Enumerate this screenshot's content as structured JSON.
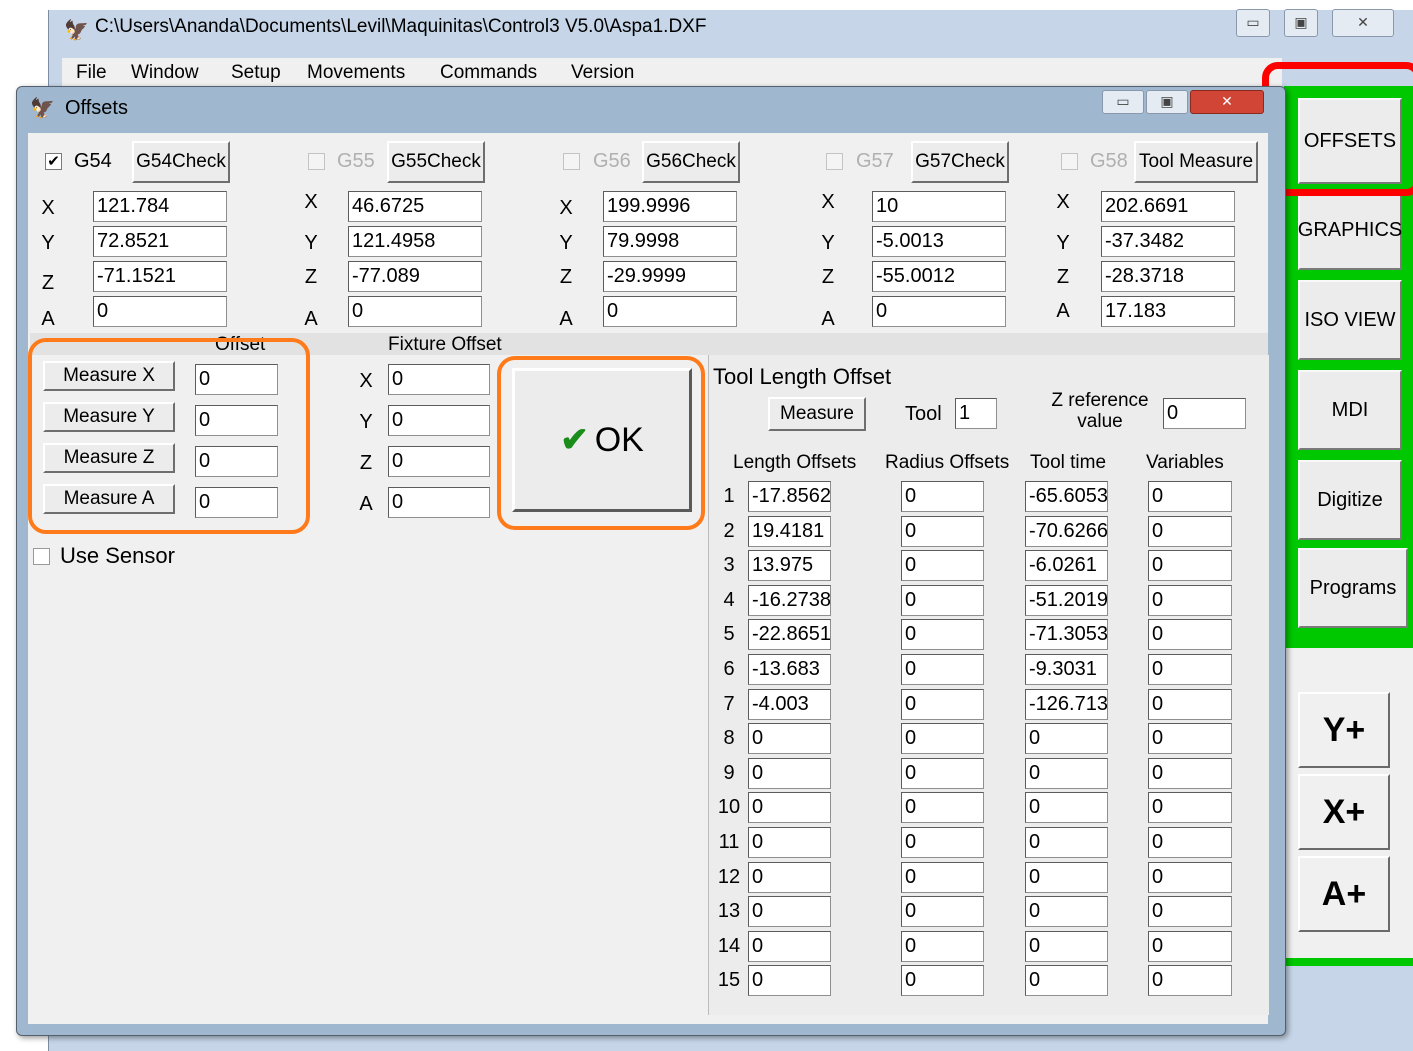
{
  "main_window": {
    "title": "C:\\Users\\Ananda\\Documents\\Levil\\Maquinitas\\Control3 V5.0\\Aspa1.DXF",
    "controls": [
      "▭",
      "▣",
      "✕"
    ],
    "menu": [
      "File",
      "Window",
      "Setup",
      "Movements",
      "Commands",
      "Version"
    ]
  },
  "side_panel": {
    "buttons": [
      "OFFSETS",
      "GRAPHICS",
      "ISO VIEW",
      "MDI",
      "Digitize",
      "Programs"
    ],
    "jog": [
      "Y+",
      "X+",
      "A+"
    ],
    "accent_color": "#00c800",
    "highlight_color": "#ff0000"
  },
  "dialog": {
    "title": "Offsets",
    "controls": [
      "▭",
      "▣",
      "✕"
    ],
    "axis_labels": [
      "X",
      "Y",
      "Z",
      "A"
    ],
    "workspaces": [
      {
        "name": "G54",
        "checked": true,
        "button": "G54Check",
        "values": [
          "121.784",
          "72.8521",
          "-71.1521",
          "0"
        ]
      },
      {
        "name": "G55",
        "checked": false,
        "button": "G55Check",
        "values": [
          "46.6725",
          "121.4958",
          "-77.089",
          "0"
        ]
      },
      {
        "name": "G56",
        "checked": false,
        "button": "G56Check",
        "values": [
          "199.9996",
          "79.9998",
          "-29.9999",
          "0"
        ]
      },
      {
        "name": "G57",
        "checked": false,
        "button": "G57Check",
        "values": [
          "10",
          "-5.0013",
          "-55.0012",
          "0"
        ]
      },
      {
        "name": "G58",
        "checked": false,
        "button": "Tool Measure",
        "values": [
          "202.6691",
          "-37.3482",
          "-28.3718",
          "17.183"
        ]
      }
    ],
    "offset": {
      "header": "Offset",
      "buttons": [
        "Measure X",
        "Measure Y",
        "Measure Z",
        "Measure A"
      ],
      "values": [
        "0",
        "0",
        "0",
        "0"
      ]
    },
    "fixture_offset": {
      "header": "Fixture Offset",
      "values": [
        "0",
        "0",
        "0",
        "0"
      ]
    },
    "ok_label": "OK",
    "use_sensor_label": "Use Sensor",
    "tool_length": {
      "title": "Tool Length Offset",
      "measure_label": "Measure",
      "tool_label": "Tool",
      "tool_value": "1",
      "zref_label_1": "Z reference",
      "zref_label_2": "value",
      "zref_value": "0",
      "columns": [
        "Length Offsets",
        "Radius Offsets",
        "Tool time",
        "Variables"
      ],
      "rows": [
        {
          "n": "1",
          "length": "-17.8562",
          "radius": "0",
          "time": "-65.6053",
          "var": "0"
        },
        {
          "n": "2",
          "length": "19.4181",
          "radius": "0",
          "time": "-70.6266",
          "var": "0"
        },
        {
          "n": "3",
          "length": "13.975",
          "radius": "0",
          "time": "-6.0261",
          "var": "0"
        },
        {
          "n": "4",
          "length": "-16.2738",
          "radius": "0",
          "time": "-51.2019",
          "var": "0"
        },
        {
          "n": "5",
          "length": "-22.8651",
          "radius": "0",
          "time": "-71.3053",
          "var": "0"
        },
        {
          "n": "6",
          "length": "-13.683",
          "radius": "0",
          "time": "-9.3031",
          "var": "0"
        },
        {
          "n": "7",
          "length": "-4.003",
          "radius": "0",
          "time": "-126.713!",
          "var": "0"
        },
        {
          "n": "8",
          "length": "0",
          "radius": "0",
          "time": "0",
          "var": "0"
        },
        {
          "n": "9",
          "length": "0",
          "radius": "0",
          "time": "0",
          "var": "0"
        },
        {
          "n": "10",
          "length": "0",
          "radius": "0",
          "time": "0",
          "var": "0"
        },
        {
          "n": "11",
          "length": "0",
          "radius": "0",
          "time": "0",
          "var": "0"
        },
        {
          "n": "12",
          "length": "0",
          "radius": "0",
          "time": "0",
          "var": "0"
        },
        {
          "n": "13",
          "length": "0",
          "radius": "0",
          "time": "0",
          "var": "0"
        },
        {
          "n": "14",
          "length": "0",
          "radius": "0",
          "time": "0",
          "var": "0"
        },
        {
          "n": "15",
          "length": "0",
          "radius": "0",
          "time": "0",
          "var": "0"
        }
      ]
    }
  }
}
